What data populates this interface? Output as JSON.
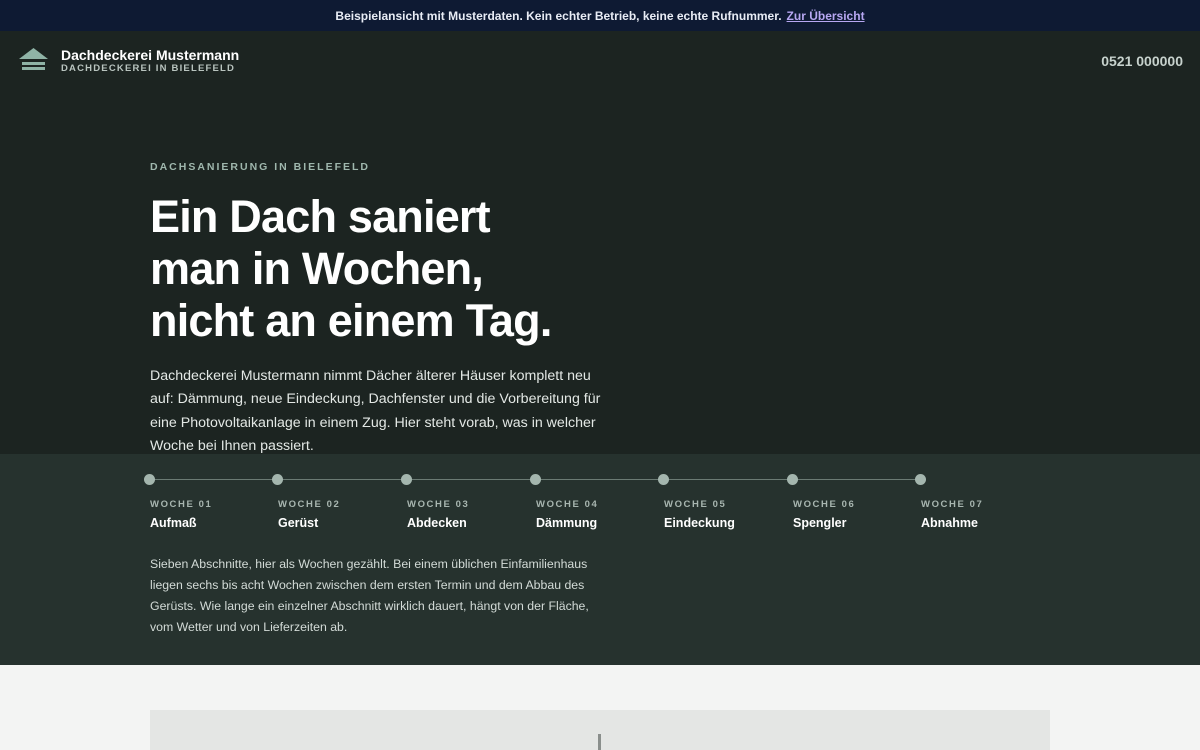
{
  "notice": {
    "text": "Beispielansicht mit Musterdaten. Kein echter Betrieb, keine echte Rufnummer.",
    "link": "Zur Übersicht"
  },
  "header": {
    "brand_name": "Dachdeckerei Mustermann",
    "brand_sub": "DACHDECKEREI IN BIELEFELD",
    "logo_icon": "roof-icon",
    "phone": "0521 000000"
  },
  "hero": {
    "eyebrow": "DACHSANIERUNG IN BIELEFELD",
    "headline": [
      "Ein Dach saniert",
      "man in Wochen,",
      "nicht an einem Tag."
    ],
    "lead": "Dachdeckerei Mustermann nimmt Dächer älterer Häuser komplett neu auf: Dämmung, neue Eindeckung, Dachfenster und die Vorbereitung für eine Photovoltaikanlage in einem Zug. Hier steht vorab, was in welcher Woche bei Ihnen passiert."
  },
  "timeline": {
    "steps": [
      {
        "week": "WOCHE 01",
        "label": "Aufmaß"
      },
      {
        "week": "WOCHE 02",
        "label": "Gerüst"
      },
      {
        "week": "WOCHE 03",
        "label": "Abdecken"
      },
      {
        "week": "WOCHE 04",
        "label": "Dämmung"
      },
      {
        "week": "WOCHE 05",
        "label": "Eindeckung"
      },
      {
        "week": "WOCHE 06",
        "label": "Spengler"
      },
      {
        "week": "WOCHE 07",
        "label": "Abnahme"
      }
    ],
    "note": "Sieben Abschnitte, hier als Wochen gezählt. Bei einem üblichen Einfamilienhaus liegen sechs bis acht Wochen zwischen dem ersten Termin und dem Abbau des Gerüsts. Wie lange ein einzelner Abschnitt wirklich dauert, hängt von der Fläche, vom Wetter und von Lieferzeiten ab."
  },
  "colors": {
    "notice_bg": "#0e1a33",
    "hero_bg": "#1c2421",
    "timeline_bg": "#26322e",
    "accent": "#9fb7ad",
    "link": "#b7a7f2"
  }
}
